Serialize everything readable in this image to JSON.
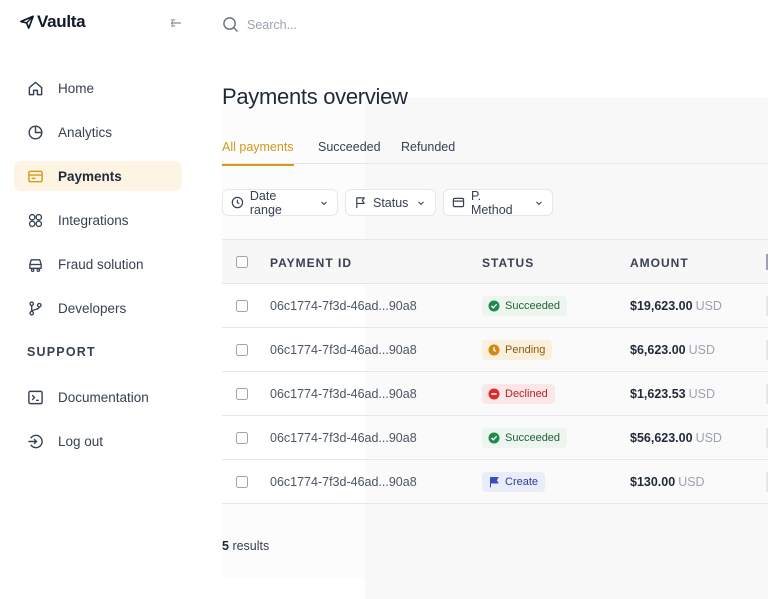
{
  "brand": {
    "name": "Vaulta"
  },
  "search": {
    "placeholder": "Search..."
  },
  "sidebar": {
    "items": [
      {
        "label": "Home",
        "icon": "home-icon"
      },
      {
        "label": "Analytics",
        "icon": "pie-chart-icon"
      },
      {
        "label": "Payments",
        "icon": "credit-card-icon",
        "active": true
      },
      {
        "label": "Integrations",
        "icon": "grid-icon"
      },
      {
        "label": "Fraud solution",
        "icon": "car-icon"
      },
      {
        "label": "Developers",
        "icon": "git-branch-icon"
      }
    ],
    "support_heading": "SUPPORT",
    "support_items": [
      {
        "label": "Documentation",
        "icon": "terminal-icon"
      },
      {
        "label": "Log out",
        "icon": "logout-icon"
      }
    ]
  },
  "page": {
    "title": "Payments overview"
  },
  "tabs": [
    {
      "label": "All payments",
      "active": true
    },
    {
      "label": "Succeeded"
    },
    {
      "label": "Refunded"
    }
  ],
  "filters": [
    {
      "label": "Date range",
      "icon": "clock-icon"
    },
    {
      "label": "Status",
      "icon": "flag-icon"
    },
    {
      "label": "P. Method",
      "icon": "card-icon"
    }
  ],
  "table": {
    "columns": [
      "PAYMENT ID",
      "STATUS",
      "AMOUNT"
    ],
    "rows": [
      {
        "id": "06c1774-7f3d-46ad...90a8",
        "status": "Succeeded",
        "status_kind": "succeeded",
        "amount": "$19,623.00",
        "currency": "USD"
      },
      {
        "id": "06c1774-7f3d-46ad...90a8",
        "status": "Pending",
        "status_kind": "pending",
        "amount": "$6,623.00",
        "currency": "USD"
      },
      {
        "id": "06c1774-7f3d-46ad...90a8",
        "status": "Declined",
        "status_kind": "declined",
        "amount": "$1,623.53",
        "currency": "USD"
      },
      {
        "id": "06c1774-7f3d-46ad...90a8",
        "status": "Succeeded",
        "status_kind": "succeeded",
        "amount": "$56,623.00",
        "currency": "USD"
      },
      {
        "id": "06c1774-7f3d-46ad...90a8",
        "status": "Create",
        "status_kind": "create",
        "amount": "$130.00",
        "currency": "USD"
      }
    ]
  },
  "results": {
    "count": "5",
    "label": "results"
  },
  "colors": {
    "accent": "#d49a1a",
    "active_nav_bg": "#fdf4e3",
    "succeeded": "#1f8a4c",
    "pending": "#d08a12",
    "declined": "#d92d2d",
    "create": "#3b4cc0"
  }
}
